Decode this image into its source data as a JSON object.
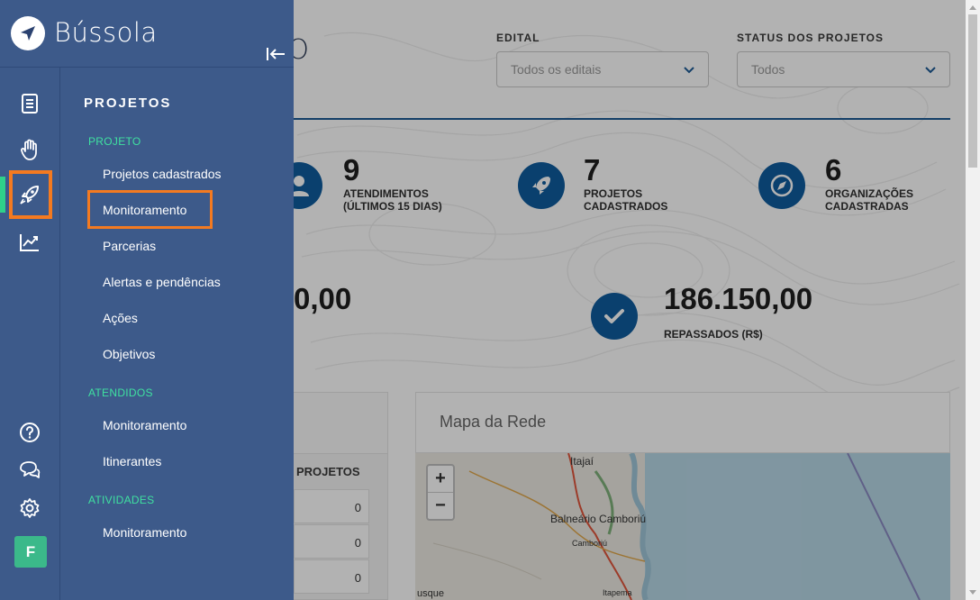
{
  "app": {
    "name": "Bússola"
  },
  "dashboard": {
    "title_fragment": "ATIVO",
    "filters": [
      {
        "label": "EDITAL",
        "value": "Todos os editais"
      },
      {
        "label": "STATUS DOS PROJETOS",
        "value": "Todos"
      }
    ],
    "stats": [
      {
        "value": "9",
        "label_line1": "ATENDIMENTOS",
        "label_line2": "(ÚLTIMOS 15 DIAS)",
        "icon": "person-icon"
      },
      {
        "value": "7",
        "label_line1": "PROJETOS",
        "label_line2": "CADASTRADOS",
        "icon": "rocket-icon"
      },
      {
        "value": "6",
        "label_line1": "ORGANIZAÇÕES",
        "label_line2": "CADASTRADAS",
        "icon": "compass-icon"
      }
    ],
    "amounts": [
      {
        "value": "0,00",
        "label": ""
      },
      {
        "value": "186.150,00",
        "label": "REPASSADOS (R$)",
        "icon": "check-icon"
      }
    ],
    "table": {
      "header": "PROJETOS",
      "rows": [
        "0",
        "0",
        "0"
      ]
    },
    "map": {
      "title": "Mapa da Rede",
      "zoom_in": "+",
      "zoom_out": "−",
      "places": [
        "Itajaí",
        "Balneário Camboriú",
        "Camboriú",
        "Itapema",
        "usque"
      ]
    }
  },
  "drawer": {
    "title": "PROJETOS",
    "sections": [
      {
        "label": "PROJETO",
        "items": [
          "Projetos cadastrados",
          "Monitoramento",
          "Parcerias",
          "Alertas e pendências",
          "Ações",
          "Objetivos"
        ]
      },
      {
        "label": "ATENDIDOS",
        "items": [
          "Monitoramento",
          "Itinerantes"
        ]
      },
      {
        "label": "ATIVIDADES",
        "items": [
          "Monitoramento"
        ]
      }
    ],
    "highlighted_item": "Monitoramento"
  },
  "rail": {
    "items": [
      "document-icon",
      "hand-icon",
      "rocket-icon",
      "chart-icon"
    ],
    "active": "rocket-icon",
    "bottom": [
      "help-icon",
      "chat-icon",
      "settings-icon"
    ],
    "avatar_initial": "F"
  },
  "colors": {
    "drawer_bg": "#3d5a8a",
    "accent_green": "#3fe0a0",
    "highlight_orange": "#f47a20",
    "brand_blue": "#0f5c9e"
  }
}
